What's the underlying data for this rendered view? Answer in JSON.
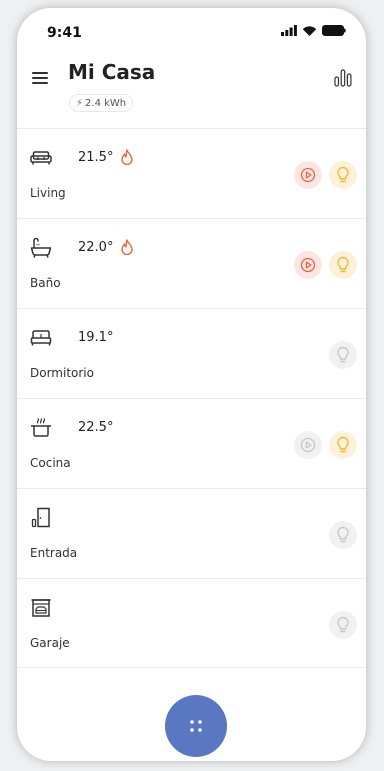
{
  "status_bar": {
    "time": "9:41"
  },
  "header": {
    "title": "Mi Casa",
    "energy": "2.4 kWh"
  },
  "rooms": [
    {
      "name": "Living",
      "temp": "21.5°",
      "icon": "sofa-icon",
      "heating": true,
      "play": "on",
      "bulb": "on"
    },
    {
      "name": "Baño",
      "temp": "22.0°",
      "icon": "bathtub-icon",
      "heating": true,
      "play": "on",
      "bulb": "on"
    },
    {
      "name": "Dormitorio",
      "temp": "19.1°",
      "icon": "bed-icon",
      "heating": false,
      "play": "none",
      "bulb": "off"
    },
    {
      "name": "Cocina",
      "temp": "22.5°",
      "icon": "cooking-pot-icon",
      "heating": false,
      "play": "off",
      "bulb": "on"
    },
    {
      "name": "Entrada",
      "temp": "",
      "icon": "door-icon",
      "heating": false,
      "play": "none",
      "bulb": "off"
    },
    {
      "name": "Garaje",
      "temp": "",
      "icon": "garage-icon",
      "heating": false,
      "play": "none",
      "bulb": "off"
    }
  ],
  "colors": {
    "accent": "#5a77c2",
    "flame": "#e8663d",
    "bulb_on": "#f0b82d",
    "inactive": "#c7c7c7"
  }
}
